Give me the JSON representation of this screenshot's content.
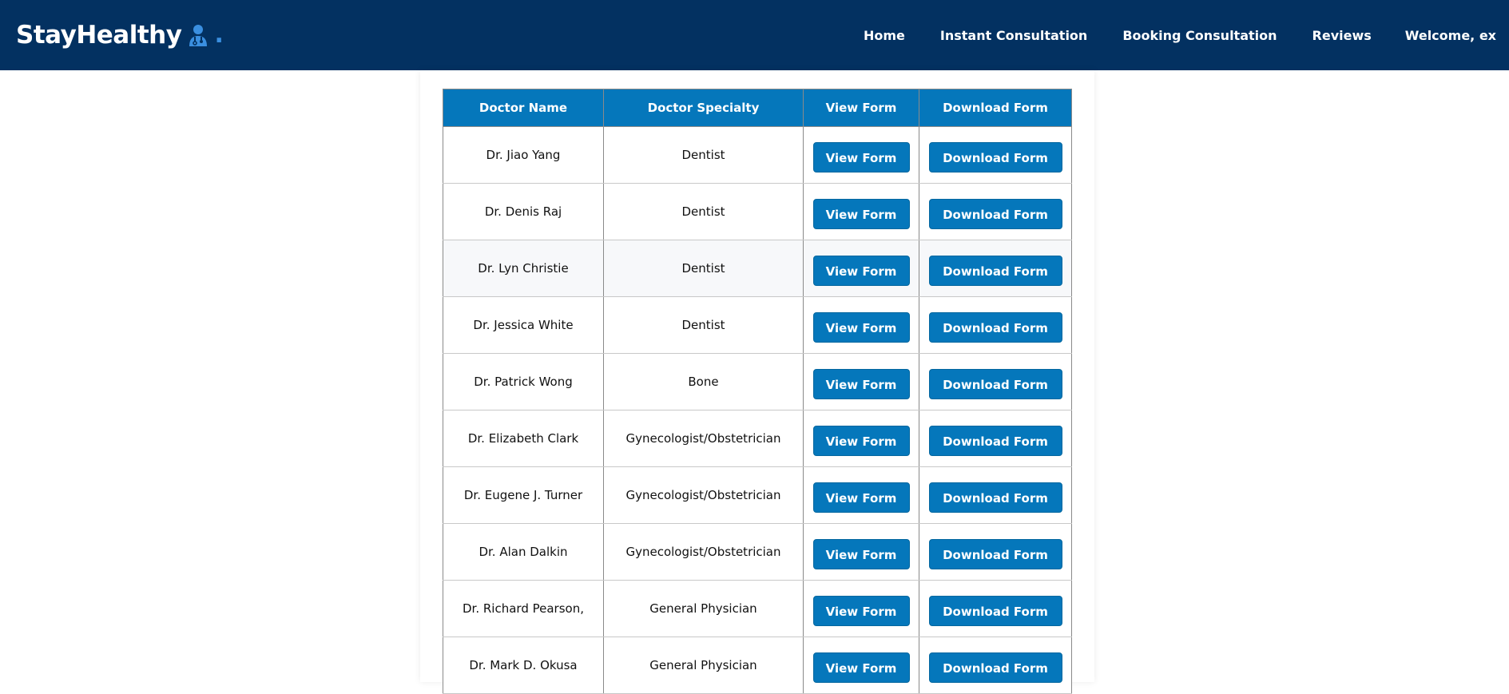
{
  "brand": {
    "name": "StayHealthy",
    "dot": ".",
    "icon": "doctor-icon"
  },
  "nav": {
    "home": "Home",
    "instant": "Instant Consultation",
    "booking": "Booking Consultation",
    "reviews": "Reviews",
    "welcome": "Welcome, ex"
  },
  "table": {
    "headers": [
      "Doctor Name",
      "Doctor Specialty",
      "View Form",
      "Download Form"
    ],
    "view_label": "View Form",
    "download_label": "Download Form",
    "rows": [
      {
        "name": "Dr. Jiao Yang",
        "specialty": "Dentist"
      },
      {
        "name": "Dr. Denis Raj",
        "specialty": "Dentist"
      },
      {
        "name": "Dr. Lyn Christie",
        "specialty": "Dentist"
      },
      {
        "name": "Dr. Jessica White",
        "specialty": "Dentist"
      },
      {
        "name": "Dr. Patrick Wong",
        "specialty": "Bone"
      },
      {
        "name": "Dr. Elizabeth Clark",
        "specialty": "Gynecologist/Obstetrician"
      },
      {
        "name": "Dr. Eugene J. Turner",
        "specialty": "Gynecologist/Obstetrician"
      },
      {
        "name": "Dr. Alan Dalkin",
        "specialty": "Gynecologist/Obstetrician"
      },
      {
        "name": "Dr. Richard Pearson,",
        "specialty": "General Physician"
      },
      {
        "name": "Dr. Mark D. Okusa",
        "specialty": "General Physician"
      }
    ]
  },
  "colors": {
    "navbar": "#033161",
    "accent": "#0577bb",
    "brand_dot": "#3a8fe0"
  }
}
